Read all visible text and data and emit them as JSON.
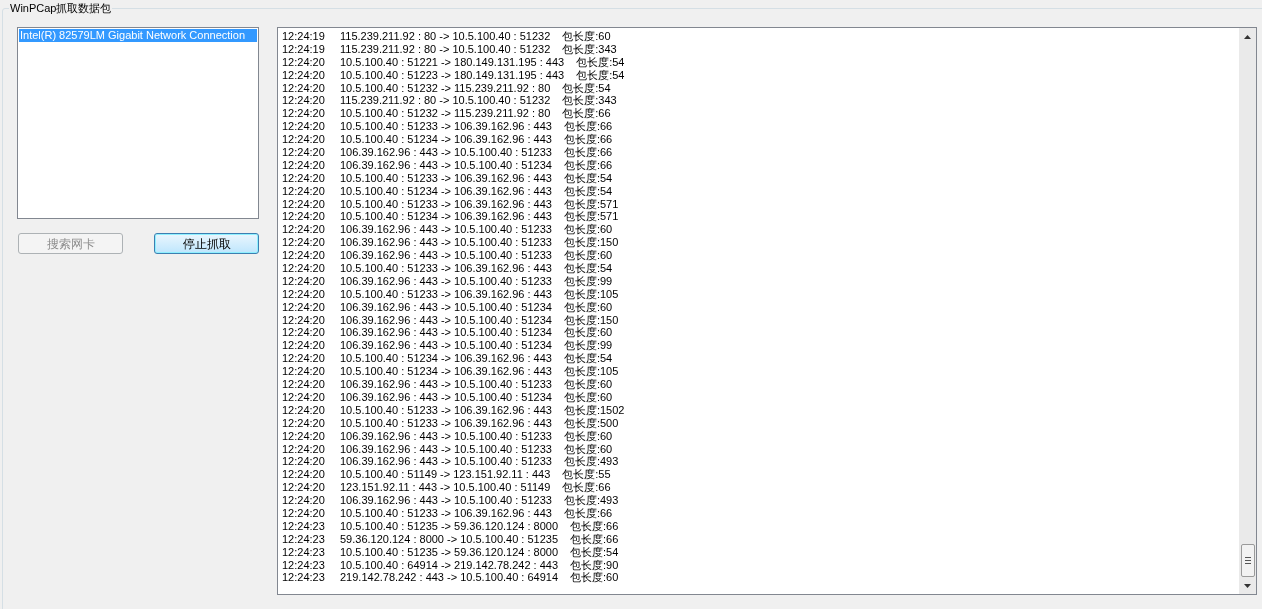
{
  "group_title": "WinPCap抓取数据包",
  "adapters": [
    {
      "label": "Intel(R) 82579LM Gigabit Network Connection",
      "selected": true
    }
  ],
  "buttons": [
    {
      "label": "搜索网卡",
      "disabled": true,
      "focused": false
    },
    {
      "label": "停止抓取",
      "disabled": false,
      "focused": true
    }
  ],
  "log": [
    {
      "time": "12:24:19",
      "flow": "115.239.211.92 : 80 -> 10.5.100.40 : 51232",
      "length": "包长度:60"
    },
    {
      "time": "12:24:19",
      "flow": "115.239.211.92 : 80 -> 10.5.100.40 : 51232",
      "length": "包长度:343"
    },
    {
      "time": "12:24:20",
      "flow": "10.5.100.40 : 51221 -> 180.149.131.195 : 443",
      "length": "包长度:54"
    },
    {
      "time": "12:24:20",
      "flow": "10.5.100.40 : 51223 -> 180.149.131.195 : 443",
      "length": "包长度:54"
    },
    {
      "time": "12:24:20",
      "flow": "10.5.100.40 : 51232 -> 115.239.211.92 : 80",
      "length": "包长度:54"
    },
    {
      "time": "12:24:20",
      "flow": "115.239.211.92 : 80 -> 10.5.100.40 : 51232",
      "length": "包长度:343"
    },
    {
      "time": "12:24:20",
      "flow": "10.5.100.40 : 51232 -> 115.239.211.92 : 80",
      "length": "包长度:66"
    },
    {
      "time": "12:24:20",
      "flow": "10.5.100.40 : 51233 -> 106.39.162.96 : 443",
      "length": "包长度:66"
    },
    {
      "time": "12:24:20",
      "flow": "10.5.100.40 : 51234 -> 106.39.162.96 : 443",
      "length": "包长度:66"
    },
    {
      "time": "12:24:20",
      "flow": "106.39.162.96 : 443 -> 10.5.100.40 : 51233",
      "length": "包长度:66"
    },
    {
      "time": "12:24:20",
      "flow": "106.39.162.96 : 443 -> 10.5.100.40 : 51234",
      "length": "包长度:66"
    },
    {
      "time": "12:24:20",
      "flow": "10.5.100.40 : 51233 -> 106.39.162.96 : 443",
      "length": "包长度:54"
    },
    {
      "time": "12:24:20",
      "flow": "10.5.100.40 : 51234 -> 106.39.162.96 : 443",
      "length": "包长度:54"
    },
    {
      "time": "12:24:20",
      "flow": "10.5.100.40 : 51233 -> 106.39.162.96 : 443",
      "length": "包长度:571"
    },
    {
      "time": "12:24:20",
      "flow": "10.5.100.40 : 51234 -> 106.39.162.96 : 443",
      "length": "包长度:571"
    },
    {
      "time": "12:24:20",
      "flow": "106.39.162.96 : 443 -> 10.5.100.40 : 51233",
      "length": "包长度:60"
    },
    {
      "time": "12:24:20",
      "flow": "106.39.162.96 : 443 -> 10.5.100.40 : 51233",
      "length": "包长度:150"
    },
    {
      "time": "12:24:20",
      "flow": "106.39.162.96 : 443 -> 10.5.100.40 : 51233",
      "length": "包长度:60"
    },
    {
      "time": "12:24:20",
      "flow": "10.5.100.40 : 51233 -> 106.39.162.96 : 443",
      "length": "包长度:54"
    },
    {
      "time": "12:24:20",
      "flow": "106.39.162.96 : 443 -> 10.5.100.40 : 51233",
      "length": "包长度:99"
    },
    {
      "time": "12:24:20",
      "flow": "10.5.100.40 : 51233 -> 106.39.162.96 : 443",
      "length": "包长度:105"
    },
    {
      "time": "12:24:20",
      "flow": "106.39.162.96 : 443 -> 10.5.100.40 : 51234",
      "length": "包长度:60"
    },
    {
      "time": "12:24:20",
      "flow": "106.39.162.96 : 443 -> 10.5.100.40 : 51234",
      "length": "包长度:150"
    },
    {
      "time": "12:24:20",
      "flow": "106.39.162.96 : 443 -> 10.5.100.40 : 51234",
      "length": "包长度:60"
    },
    {
      "time": "12:24:20",
      "flow": "106.39.162.96 : 443 -> 10.5.100.40 : 51234",
      "length": "包长度:99"
    },
    {
      "time": "12:24:20",
      "flow": "10.5.100.40 : 51234 -> 106.39.162.96 : 443",
      "length": "包长度:54"
    },
    {
      "time": "12:24:20",
      "flow": "10.5.100.40 : 51234 -> 106.39.162.96 : 443",
      "length": "包长度:105"
    },
    {
      "time": "12:24:20",
      "flow": "106.39.162.96 : 443 -> 10.5.100.40 : 51233",
      "length": "包长度:60"
    },
    {
      "time": "12:24:20",
      "flow": "106.39.162.96 : 443 -> 10.5.100.40 : 51234",
      "length": "包长度:60"
    },
    {
      "time": "12:24:20",
      "flow": "10.5.100.40 : 51233 -> 106.39.162.96 : 443",
      "length": "包长度:1502"
    },
    {
      "time": "12:24:20",
      "flow": "10.5.100.40 : 51233 -> 106.39.162.96 : 443",
      "length": "包长度:500"
    },
    {
      "time": "12:24:20",
      "flow": "106.39.162.96 : 443 -> 10.5.100.40 : 51233",
      "length": "包长度:60"
    },
    {
      "time": "12:24:20",
      "flow": "106.39.162.96 : 443 -> 10.5.100.40 : 51233",
      "length": "包长度:60"
    },
    {
      "time": "12:24:20",
      "flow": "106.39.162.96 : 443 -> 10.5.100.40 : 51233",
      "length": "包长度:493"
    },
    {
      "time": "12:24:20",
      "flow": "10.5.100.40 : 51149 -> 123.151.92.11 : 443",
      "length": "包长度:55"
    },
    {
      "time": "12:24:20",
      "flow": "123.151.92.11 : 443 -> 10.5.100.40 : 51149",
      "length": "包长度:66"
    },
    {
      "time": "12:24:20",
      "flow": "106.39.162.96 : 443 -> 10.5.100.40 : 51233",
      "length": "包长度:493"
    },
    {
      "time": "12:24:20",
      "flow": "10.5.100.40 : 51233 -> 106.39.162.96 : 443",
      "length": "包长度:66"
    },
    {
      "time": "12:24:23",
      "flow": "10.5.100.40 : 51235 -> 59.36.120.124 : 8000",
      "length": "包长度:66"
    },
    {
      "time": "12:24:23",
      "flow": "59.36.120.124 : 8000 -> 10.5.100.40 : 51235",
      "length": "包长度:66"
    },
    {
      "time": "12:24:23",
      "flow": "10.5.100.40 : 51235 -> 59.36.120.124 : 8000",
      "length": "包长度:54"
    },
    {
      "time": "12:24:23",
      "flow": "10.5.100.40 : 64914 -> 219.142.78.242 : 443",
      "length": "包长度:90"
    },
    {
      "time": "12:24:23",
      "flow": "219.142.78.242 : 443 -> 10.5.100.40 : 64914",
      "length": "包长度:60"
    }
  ]
}
